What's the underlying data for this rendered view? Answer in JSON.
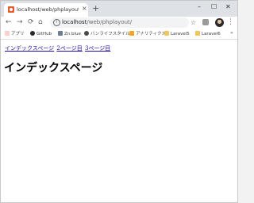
{
  "browser": {
    "tab": {
      "title": "localhost/web/phplayout/",
      "close_label": "×"
    },
    "new_tab_label": "+",
    "window_controls": {
      "minimize": "–",
      "maximize": "☐",
      "close": "✕"
    },
    "nav": {
      "back": "←",
      "forward": "→",
      "reload": "⟳",
      "home": "⌂"
    },
    "address": {
      "info_icon": "i",
      "host": "localhost",
      "path": "/web/phplayout/"
    },
    "star": "☆",
    "menu": "⋮"
  },
  "bookmarks": {
    "items": [
      {
        "label": "アプリ",
        "icon": "apps-icon"
      },
      {
        "label": "GitHub",
        "icon": "github-icon"
      },
      {
        "label": "Zn.blue",
        "icon": "zn-icon"
      },
      {
        "label": "バンライフスタイル",
        "icon": "cloud-icon"
      },
      {
        "label": "アナリティクス",
        "icon": "analytics-icon"
      },
      {
        "label": "Laravel5",
        "icon": "folder-icon"
      },
      {
        "label": "Laravel6",
        "icon": "folder-icon"
      }
    ],
    "more": "»"
  },
  "page": {
    "links": [
      "インデックスページ",
      "2ページ目",
      "3ページ目"
    ],
    "heading": "インデックスページ"
  }
}
